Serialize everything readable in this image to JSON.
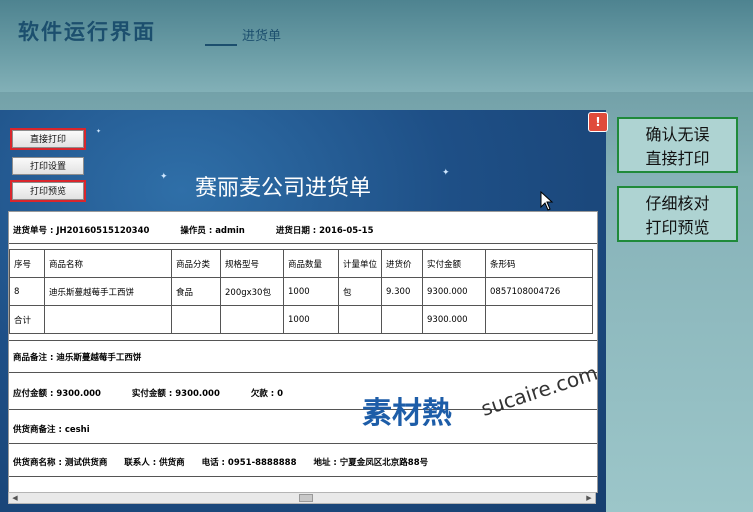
{
  "header": {
    "title": "软件运行界面",
    "subtitle": "进货单"
  },
  "toolbar": {
    "direct_print": "直接打印",
    "print_setup": "打印设置",
    "print_preview": "打印预览"
  },
  "close_glyph": "!",
  "document": {
    "title": "赛丽麦公司进货单",
    "info": {
      "order_no": "进货单号 : JH20160515120340",
      "operator": "操作员 : admin",
      "date": "进货日期 : 2016-05-15"
    },
    "columns": [
      "序号",
      "商品名称",
      "商品分类",
      "规格型号",
      "商品数量",
      "计量单位",
      "进货价",
      "实付金额",
      "条形码"
    ],
    "rows": [
      [
        "8",
        "迪乐斯蔓越莓手工西饼",
        "食品",
        "200gx30包",
        "1000",
        "包",
        "9.300",
        "9300.000",
        "0857108004726"
      ],
      [
        "合计",
        "",
        "",
        "",
        "1000",
        "",
        "",
        "9300.000",
        ""
      ]
    ],
    "goods_note": "商品备注 : 迪乐斯蔓越莓手工西饼",
    "payable": "应付金额 : 9300.000",
    "paid": "实付金额 : 9300.000",
    "owed": "欠款 : 0",
    "supplier_note": "供货商备注 : ceshi",
    "supplier_name": "供货商名称 : 测试供货商",
    "contact": "联系人 : 供货商",
    "phone": "电话 : 0951-8888888",
    "address": "地址 : 宁夏金凤区北京路88号"
  },
  "watermark": {
    "cn": "素材熱",
    "latin": "sucaire.com"
  },
  "notes": [
    {
      "line1": "确认无误",
      "line2": "直接打印"
    },
    {
      "line1": "仔细核对",
      "line2": "打印预览"
    }
  ]
}
